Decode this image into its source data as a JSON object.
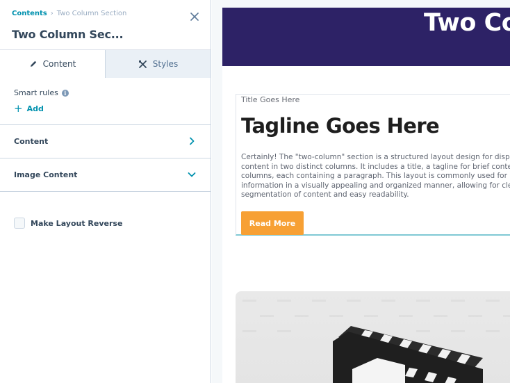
{
  "panel": {
    "breadcrumb": {
      "root": "Contents",
      "current": "Two Column Section"
    },
    "title": "Two Column Sec...",
    "tabs": [
      {
        "label": "Content",
        "icon": "pencil-icon",
        "active": true
      },
      {
        "label": "Styles",
        "icon": "styles-icon",
        "active": false
      }
    ],
    "smart_rules": {
      "label": "Smart rules",
      "add_label": "Add"
    },
    "sections": [
      {
        "label": "Content",
        "icon": "chevron-right-icon"
      },
      {
        "label": "Image Content",
        "icon": "chevron-down-icon"
      }
    ],
    "checkbox": {
      "label": "Make Layout Reverse",
      "checked": false
    }
  },
  "preview": {
    "hero_title": "Two Co",
    "card": {
      "kicker": "Title Goes Here",
      "tagline": "Tagline Goes Here",
      "body_lines": [
        "Certainly! The \"two-column\" section is a structured layout design for displa",
        "content in two distinct columns. It includes a title, a tagline for brief context",
        "columns, each containing a paragraph. This layout is commonly used for pre",
        "information in a visually appealing and organized manner, allowing for clear",
        "segmentation of content and easy readability."
      ],
      "button_label": "Read More"
    }
  },
  "colors": {
    "accent": "#0091ae",
    "hero_bg": "#2d2266",
    "button_bg": "#f7a034",
    "text_primary": "#33475b"
  }
}
